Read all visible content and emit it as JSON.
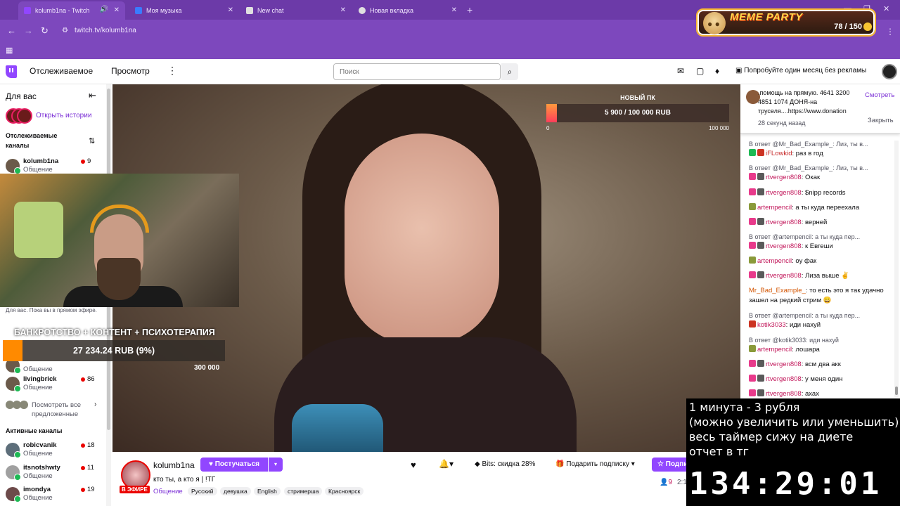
{
  "browser": {
    "tabs": [
      {
        "title": "kolumb1na - Twitch",
        "active": true
      },
      {
        "title": "Моя музыка",
        "active": false
      },
      {
        "title": "New chat",
        "active": false
      },
      {
        "title": "Новая вкладка",
        "active": false
      }
    ],
    "url": "twitch.tv/kolumb1na"
  },
  "meme_widget": {
    "title": "MEME PARTY",
    "score": "78 / 150",
    "progress": 0.52
  },
  "topnav": {
    "following": "Отслеживаемое",
    "browse": "Просмотр",
    "search_placeholder": "Поиск",
    "promo": "Попробуйте один месяц без рекламы"
  },
  "sidebar": {
    "title": "Для вас",
    "stories_link": "Открыть истории",
    "followed_title": "Отслеживаемые каналы",
    "followed": [
      {
        "name": "kolumb1na",
        "category": "Общение",
        "viewers": "9"
      },
      {
        "name": "",
        "category": "Общение",
        "viewers": ""
      },
      {
        "name": "livingbrick",
        "category": "Общение",
        "viewers": "86"
      }
    ],
    "see_all": "Посмотреть все предложенные",
    "active_title": "Активные каналы",
    "active": [
      {
        "name": "robicvanik",
        "category": "Общение",
        "viewers": "18"
      },
      {
        "name": "itsnotshwty",
        "category": "Общение",
        "viewers": "11"
      },
      {
        "name": "imondya",
        "category": "Общение",
        "viewers": "19"
      }
    ],
    "cam_note": "Для вас. Пока вы в прямом эфире."
  },
  "video": {
    "goal_top": {
      "title": "НОВЫЙ ПК",
      "value": "5 900 / 100 000 RUB",
      "min": "0",
      "max": "100 000",
      "progress": 0.059
    },
    "goal_left": {
      "title": "БАНКРОТСТВО + КОНТЕНТ + ПСИХОТЕРАПИЯ",
      "value": "27 234.24 RUB (9%)",
      "max": "300 000",
      "progress": 0.09
    }
  },
  "stream_info": {
    "name": "kolumb1na",
    "live_badge": "В ЭФИРЕ",
    "follow": "Постучаться",
    "title": "кто ты, а кто я | !TГ",
    "category": "Общение",
    "tags": [
      "Русский",
      "девушка",
      "English",
      "стримерша",
      "Красноярск"
    ],
    "bits": "Bits: скидка 28%",
    "gift": "Подарить подписку",
    "subscribe": "Подпи",
    "viewers": "9",
    "uptime": "2:1"
  },
  "chat": {
    "pinned": {
      "text": ".помощь на прямую. 4641 3200 4851 1074 ДОНЯ-на труселя....https://www.donation",
      "time": "28 секунд назад",
      "watch": "Смотреть",
      "close": "Закрыть"
    },
    "messages": [
      {
        "reply": "В ответ @Mr_Bad_Example_: Лиз, ты в...",
        "user": "iFLowkid",
        "text": ": раз в год",
        "color": "u-red",
        "badges": [
          "b-green",
          "b-red"
        ]
      },
      {
        "reply": "В ответ @Mr_Bad_Example_: Лиз, ты в...",
        "user": "rtvergen808",
        "text": ": Окак",
        "color": "u-pink",
        "badges": [
          "b-pink",
          "b-gray"
        ]
      },
      {
        "reply": "",
        "user": "rtvergen808",
        "text": ": $nipp records",
        "color": "u-pink",
        "badges": [
          "b-pink",
          "b-gray"
        ]
      },
      {
        "reply": "",
        "user": "artempencil",
        "text": ": а ты куда переехала",
        "color": "u-pink",
        "badges": [
          "b-olive"
        ]
      },
      {
        "reply": "",
        "user": "rtvergen808",
        "text": ": верней",
        "color": "u-pink",
        "badges": [
          "b-pink",
          "b-gray"
        ]
      },
      {
        "reply": "В ответ @artempencil: а ты куда пер...",
        "user": "rtvergen808",
        "text": ": к Евгеши",
        "color": "u-pink",
        "badges": [
          "b-pink",
          "b-gray"
        ]
      },
      {
        "reply": "",
        "user": "artempencil",
        "text": ": оу фак",
        "color": "u-pink",
        "badges": [
          "b-olive"
        ]
      },
      {
        "reply": "",
        "user": "rtvergen808",
        "text": ": Лиза выше ✌",
        "color": "u-pink",
        "badges": [
          "b-pink",
          "b-gray"
        ]
      },
      {
        "reply": "",
        "user": "Mr_Bad_Example_",
        "text": ": то есть это я так удачно зашел на редкий стрим 😄",
        "color": "u-orange",
        "badges": []
      },
      {
        "reply": "В ответ @artempencil: а ты куда пер...",
        "user": "kotik3033",
        "text": ": иди нахуй",
        "color": "u-pink",
        "badges": [
          "b-red"
        ]
      },
      {
        "reply": "В ответ @kotik3033: иди нахуй",
        "user": "artempencil",
        "text": ": лошара",
        "color": "u-pink",
        "badges": [
          "b-olive"
        ]
      },
      {
        "reply": "",
        "user": "rtvergen808",
        "text": ": всм два акк",
        "color": "u-pink",
        "badges": [
          "b-pink",
          "b-gray"
        ]
      },
      {
        "reply": "",
        "user": "rtvergen808",
        "text": ": у меня один",
        "color": "u-pink",
        "badges": [
          "b-pink",
          "b-gray"
        ]
      },
      {
        "reply": "",
        "user": "rtvergen808",
        "text": ": ахах",
        "color": "u-pink",
        "badges": [
          "b-pink",
          "b-gray"
        ]
      }
    ]
  },
  "overlay": {
    "lines": [
      "1 минута - 3 рубля",
      "(можно увеличить или уменьшить)",
      "весь таймер сижу на диете",
      "отчет в тг"
    ],
    "timer": "134:29:01"
  }
}
